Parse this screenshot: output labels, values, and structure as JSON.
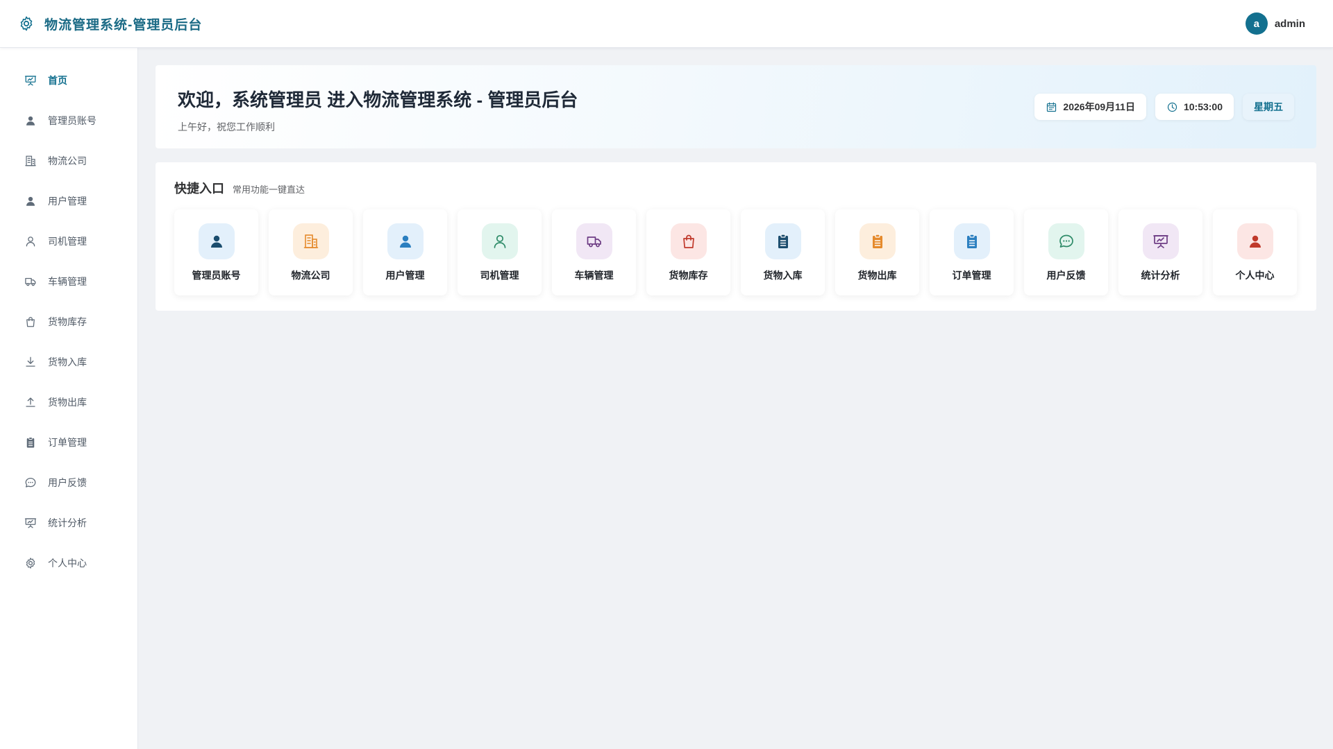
{
  "header": {
    "title": "物流管理系统-管理员后台",
    "brand_icon": "gear-icon",
    "avatar_letter": "a",
    "username": "admin"
  },
  "sidebar": {
    "items": [
      {
        "label": "首页",
        "icon": "presentation-chart-icon",
        "active": true
      },
      {
        "label": "管理员账号",
        "icon": "user-solid-icon"
      },
      {
        "label": "物流公司",
        "icon": "building-icon"
      },
      {
        "label": "用户管理",
        "icon": "user-solid-icon"
      },
      {
        "label": "司机管理",
        "icon": "user-outline-icon"
      },
      {
        "label": "车辆管理",
        "icon": "truck-icon"
      },
      {
        "label": "货物库存",
        "icon": "shopping-bag-icon"
      },
      {
        "label": "货物入库",
        "icon": "download-icon"
      },
      {
        "label": "货物出库",
        "icon": "upload-icon"
      },
      {
        "label": "订单管理",
        "icon": "clipboard-icon"
      },
      {
        "label": "用户反馈",
        "icon": "chat-bubble-icon"
      },
      {
        "label": "统计分析",
        "icon": "presentation-chart-icon"
      },
      {
        "label": "个人中心",
        "icon": "gear-icon"
      }
    ]
  },
  "welcome": {
    "title": "欢迎，系统管理员 进入物流管理系统 - 管理员后台",
    "subtitle": "上午好，祝您工作顺利",
    "date": "2026年09月11日",
    "time": "10:53:00",
    "weekday": "星期五"
  },
  "quick": {
    "title": "快捷入口",
    "subtitle": "常用功能一键直达",
    "cards": [
      {
        "label": "管理员账号",
        "icon": "user-solid-icon",
        "bg": "#e3f0fb",
        "fg": "#1b4d6e"
      },
      {
        "label": "物流公司",
        "icon": "building-icon",
        "bg": "#fdeedd",
        "fg": "#e58a2c"
      },
      {
        "label": "用户管理",
        "icon": "user-solid-icon",
        "bg": "#e3f0fb",
        "fg": "#2b7fc0"
      },
      {
        "label": "司机管理",
        "icon": "user-outline-icon",
        "bg": "#e2f5ee",
        "fg": "#2e8b68"
      },
      {
        "label": "车辆管理",
        "icon": "truck-icon",
        "bg": "#f1e7f5",
        "fg": "#6d3c84"
      },
      {
        "label": "货物库存",
        "icon": "shopping-bag-icon",
        "bg": "#fce6e4",
        "fg": "#c0392b"
      },
      {
        "label": "货物入库",
        "icon": "clipboard-icon",
        "bg": "#e3f0fb",
        "fg": "#1b4d6e"
      },
      {
        "label": "货物出库",
        "icon": "clipboard-icon",
        "bg": "#fdeedd",
        "fg": "#e58a2c"
      },
      {
        "label": "订单管理",
        "icon": "clipboard-icon",
        "bg": "#e3f0fb",
        "fg": "#2b7fc0"
      },
      {
        "label": "用户反馈",
        "icon": "chat-bubble-icon",
        "bg": "#e2f5ee",
        "fg": "#2e8b68"
      },
      {
        "label": "统计分析",
        "icon": "presentation-chart-icon",
        "bg": "#f1e7f5",
        "fg": "#6d3c84"
      },
      {
        "label": "个人中心",
        "icon": "user-solid-icon",
        "bg": "#fce6e4",
        "fg": "#c0392b"
      }
    ]
  },
  "colors": {
    "accent": "#13708f",
    "sidebar_icon": "#5f6b78"
  }
}
